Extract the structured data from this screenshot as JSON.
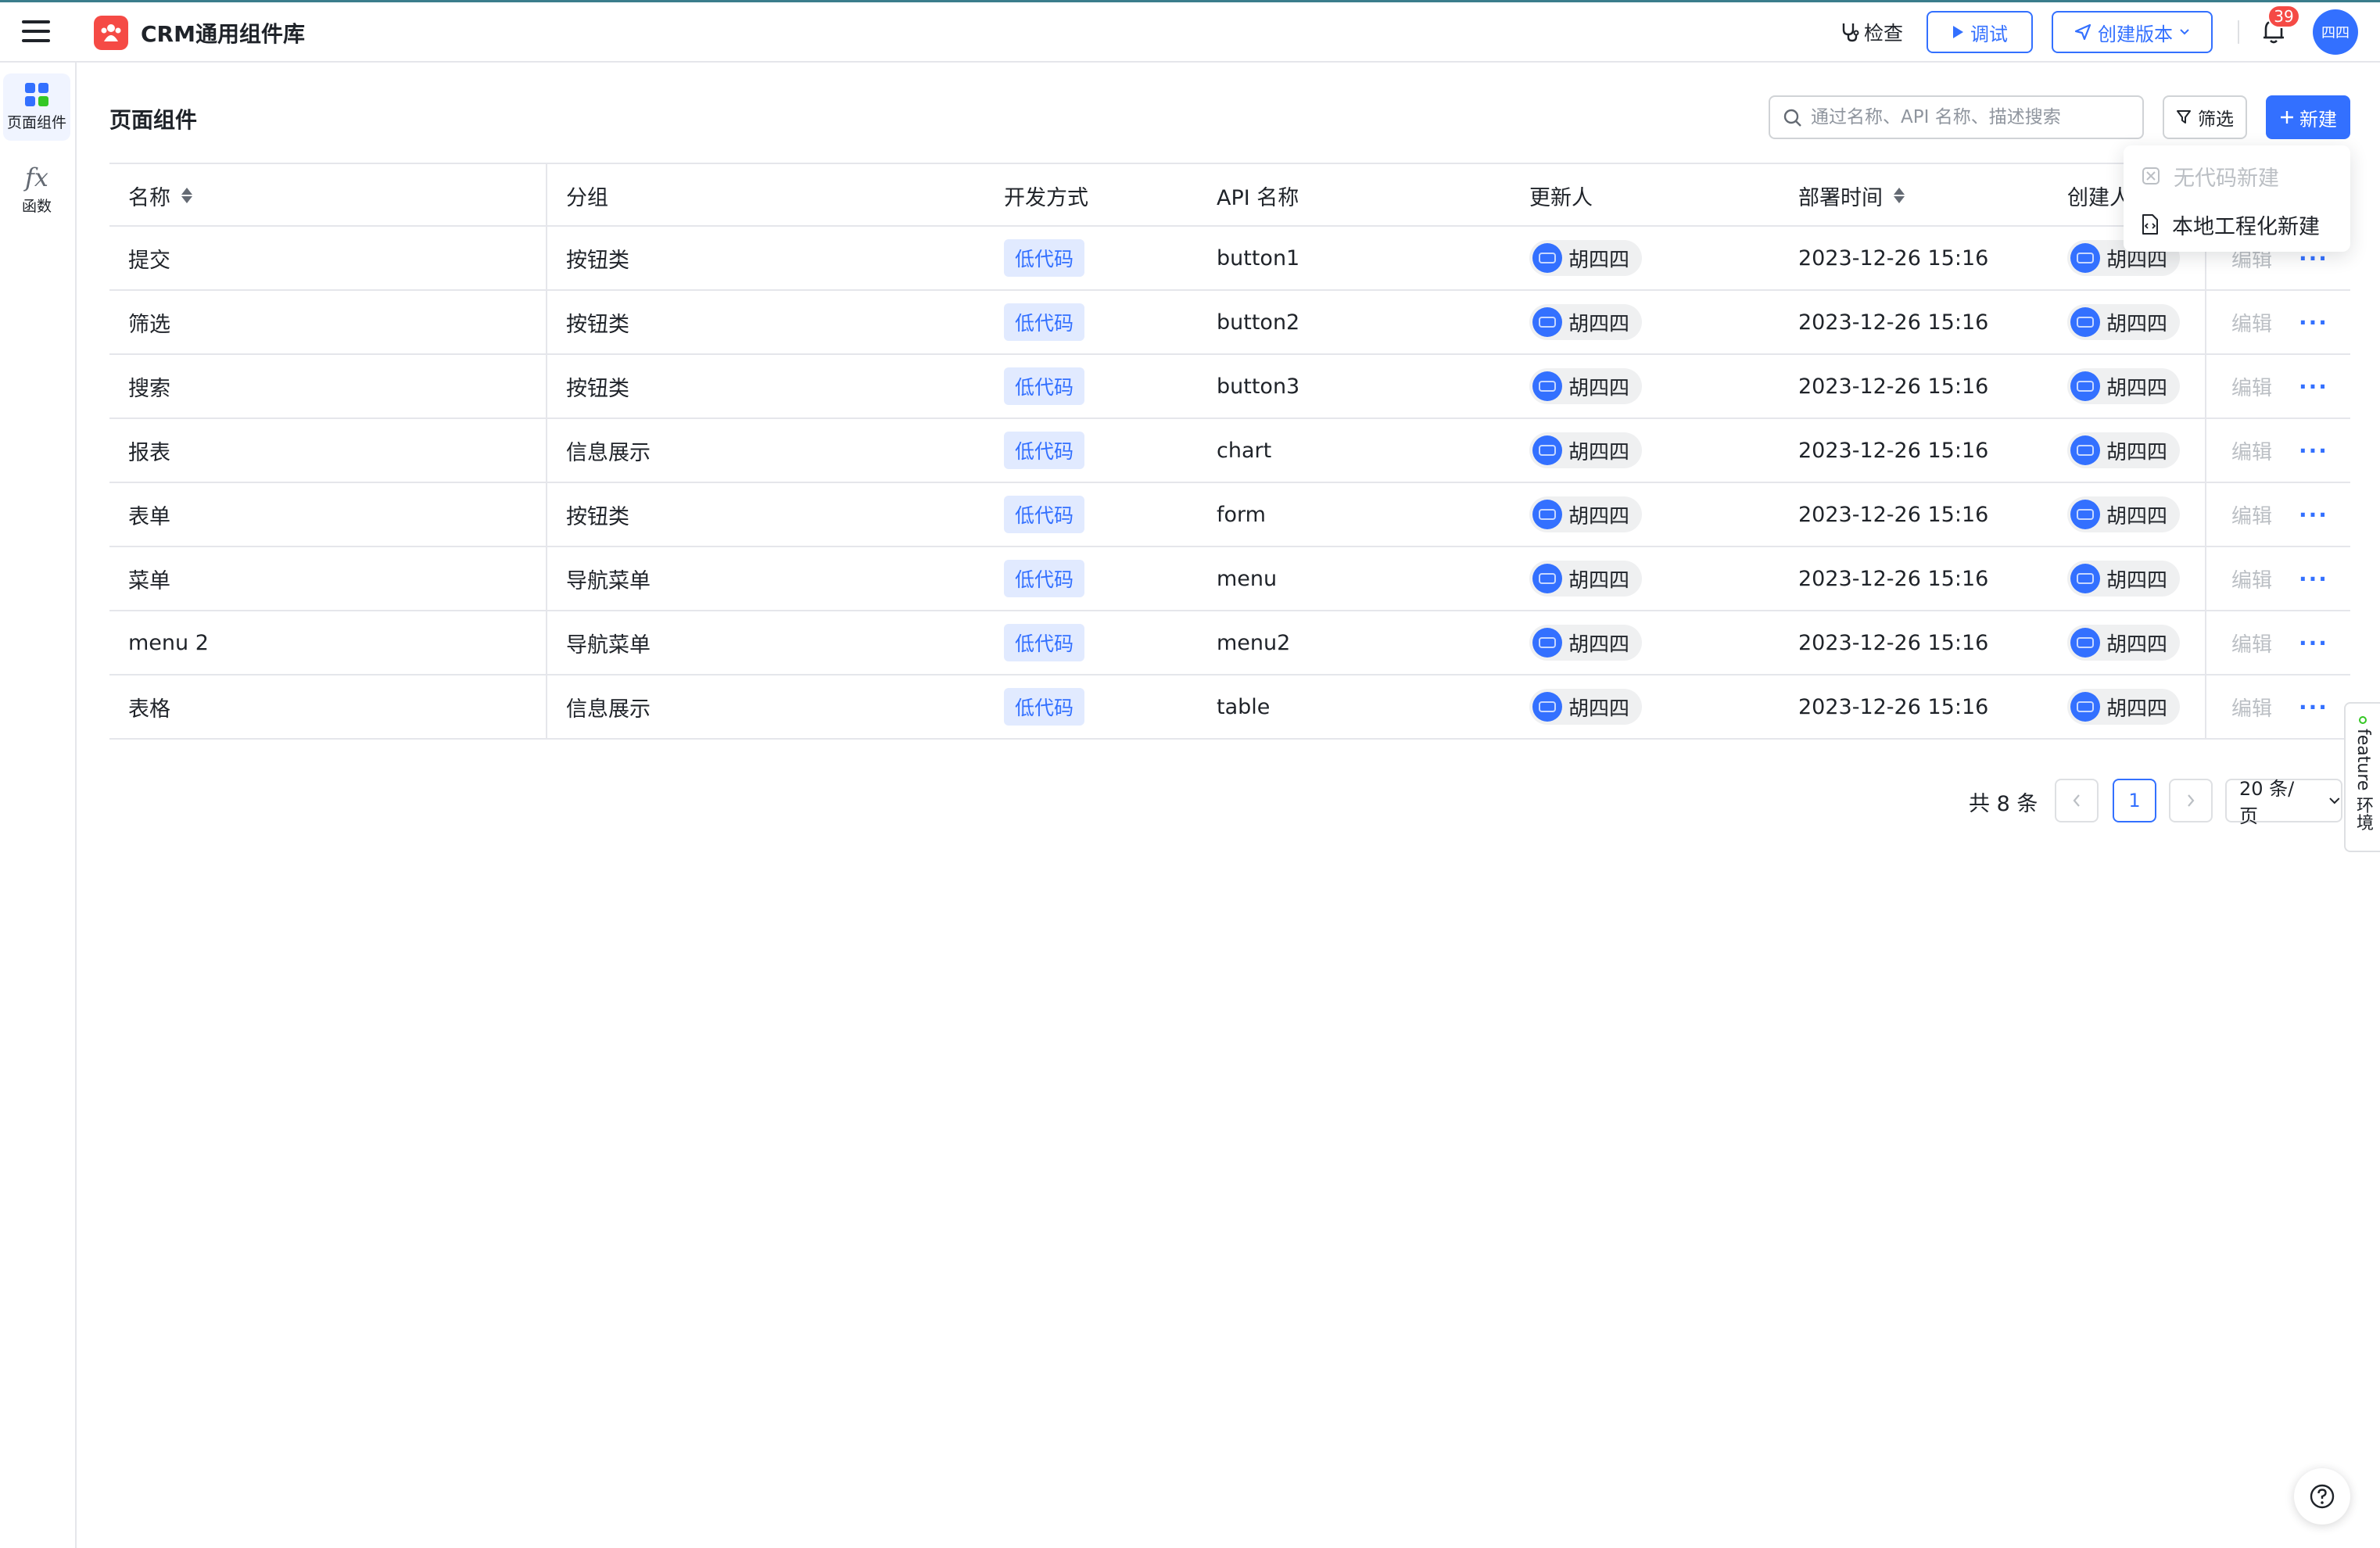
{
  "header": {
    "app_title": "CRM通用组件库",
    "check_label": "检查",
    "debug_label": "调试",
    "release_label": "创建版本",
    "notification_count": "39",
    "avatar_text": "四四"
  },
  "rail": {
    "items": [
      {
        "label": "页面组件",
        "icon": "grid-icon",
        "active": true
      },
      {
        "label": "函数",
        "icon": "fx-icon",
        "active": false
      }
    ]
  },
  "page": {
    "title": "页面组件",
    "search_placeholder": "通过名称、API 名称、描述搜索",
    "filter_label": "筛选",
    "new_label": "新建"
  },
  "dropdown": {
    "items": [
      {
        "label": "无代码新建",
        "disabled": true,
        "icon": "nocode-icon"
      },
      {
        "label": "本地工程化新建",
        "disabled": false,
        "icon": "code-file-icon"
      }
    ]
  },
  "table": {
    "columns": [
      "名称",
      "分组",
      "开发方式",
      "API 名称",
      "更新人",
      "部署时间",
      "创建人"
    ],
    "edit_label": "编辑",
    "more_label": "···",
    "rows": [
      {
        "name": "提交",
        "group": "按钮类",
        "dev": "低代码",
        "api": "button1",
        "updater": "胡四四",
        "time": "2023-12-26 15:16",
        "creator": "胡四四"
      },
      {
        "name": "筛选",
        "group": "按钮类",
        "dev": "低代码",
        "api": "button2",
        "updater": "胡四四",
        "time": "2023-12-26 15:16",
        "creator": "胡四四"
      },
      {
        "name": "搜索",
        "group": "按钮类",
        "dev": "低代码",
        "api": "button3",
        "updater": "胡四四",
        "time": "2023-12-26 15:16",
        "creator": "胡四四"
      },
      {
        "name": "报表",
        "group": "信息展示",
        "dev": "低代码",
        "api": "chart",
        "updater": "胡四四",
        "time": "2023-12-26 15:16",
        "creator": "胡四四"
      },
      {
        "name": "表单",
        "group": "按钮类",
        "dev": "低代码",
        "api": "form",
        "updater": "胡四四",
        "time": "2023-12-26 15:16",
        "creator": "胡四四"
      },
      {
        "name": "菜单",
        "group": "导航菜单",
        "dev": "低代码",
        "api": "menu",
        "updater": "胡四四",
        "time": "2023-12-26 15:16",
        "creator": "胡四四"
      },
      {
        "name": "menu 2",
        "group": "导航菜单",
        "dev": "低代码",
        "api": "menu2",
        "updater": "胡四四",
        "time": "2023-12-26 15:16",
        "creator": "胡四四"
      },
      {
        "name": "表格",
        "group": "信息展示",
        "dev": "低代码",
        "api": "table",
        "updater": "胡四四",
        "time": "2023-12-26 15:16",
        "creator": "胡四四"
      }
    ]
  },
  "pagination": {
    "total_text": "共 8 条",
    "current_page": "1",
    "page_size": "20 条/页"
  },
  "feature_tab": {
    "label": "feature 环境"
  },
  "colors": {
    "primary": "#3370ff",
    "danger": "#f54a45",
    "tag_bg": "#e1eaff"
  }
}
